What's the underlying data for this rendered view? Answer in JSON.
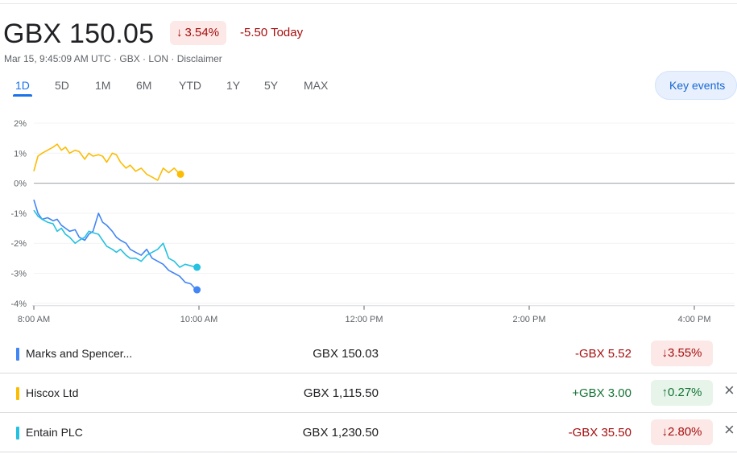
{
  "quote": {
    "price": "GBX 150.05",
    "change_pct": "3.54%",
    "change_today": "-5.50 Today",
    "meta": "Mar 15, 9:45:09 AM UTC · GBX · LON · Disclaimer"
  },
  "tabs": [
    {
      "label": "1D",
      "active": true
    },
    {
      "label": "5D"
    },
    {
      "label": "1M"
    },
    {
      "label": "6M"
    },
    {
      "label": "YTD"
    },
    {
      "label": "1Y"
    },
    {
      "label": "5Y"
    },
    {
      "label": "MAX"
    }
  ],
  "key_events_label": "Key events",
  "colors": {
    "blue": "#4285f4",
    "yellow": "#fbbc04",
    "teal": "#24c1e0",
    "red": "#a50e0e",
    "green": "#137333",
    "accent": "#1a73e8"
  },
  "chart_data": {
    "type": "line",
    "x_ticks": [
      "8:00 AM",
      "10:00 AM",
      "12:00 PM",
      "2:00 PM",
      "4:00 PM"
    ],
    "y_ticks": [
      "2%",
      "1%",
      "0%",
      "-1%",
      "-2%",
      "-3%",
      "-4%"
    ],
    "ylim": [
      -4,
      2
    ],
    "xlim_minutes_from_open": [
      0,
      510
    ],
    "grid": true,
    "baseline": 0,
    "series": [
      {
        "name": "Hiscox Ltd",
        "color": "#fbbc04",
        "x": [
          0,
          3,
          6,
          10,
          14,
          17,
          20,
          23,
          26,
          30,
          33,
          37,
          40,
          43,
          47,
          50,
          53,
          57,
          60,
          63,
          67,
          70,
          74,
          78,
          82,
          86,
          90,
          94,
          98,
          102,
          106
        ],
        "y": [
          0.4,
          0.9,
          1.0,
          1.1,
          1.2,
          1.3,
          1.1,
          1.2,
          1.0,
          1.1,
          1.05,
          0.8,
          1.0,
          0.9,
          0.95,
          0.9,
          0.7,
          1.0,
          0.95,
          0.7,
          0.5,
          0.6,
          0.4,
          0.5,
          0.3,
          0.2,
          0.1,
          0.5,
          0.35,
          0.5,
          0.3
        ]
      },
      {
        "name": "Marks and Spencer...",
        "color": "#4285f4",
        "x": [
          0,
          3,
          6,
          10,
          14,
          17,
          20,
          23,
          26,
          30,
          33,
          37,
          40,
          43,
          47,
          50,
          53,
          57,
          60,
          63,
          67,
          70,
          74,
          78,
          82,
          86,
          90,
          94,
          98,
          102,
          106,
          110,
          114,
          118
        ],
        "y": [
          -0.55,
          -1.0,
          -1.2,
          -1.15,
          -1.25,
          -1.2,
          -1.4,
          -1.5,
          -1.6,
          -1.55,
          -1.8,
          -1.9,
          -1.7,
          -1.6,
          -1.0,
          -1.3,
          -1.4,
          -1.6,
          -1.8,
          -1.9,
          -2.0,
          -2.2,
          -2.3,
          -2.4,
          -2.2,
          -2.5,
          -2.6,
          -2.7,
          -2.9,
          -3.0,
          -3.1,
          -3.3,
          -3.35,
          -3.55
        ]
      },
      {
        "name": "Entain PLC",
        "color": "#24c1e0",
        "x": [
          0,
          3,
          6,
          10,
          14,
          17,
          20,
          23,
          26,
          30,
          33,
          37,
          40,
          43,
          47,
          50,
          53,
          57,
          60,
          63,
          67,
          70,
          74,
          78,
          82,
          86,
          90,
          94,
          98,
          102,
          106,
          110,
          114,
          118
        ],
        "y": [
          -0.9,
          -1.1,
          -1.2,
          -1.3,
          -1.35,
          -1.6,
          -1.5,
          -1.7,
          -1.8,
          -2.0,
          -1.9,
          -1.8,
          -1.6,
          -1.65,
          -1.7,
          -1.9,
          -2.1,
          -2.2,
          -2.3,
          -2.2,
          -2.4,
          -2.5,
          -2.5,
          -2.6,
          -2.4,
          -2.3,
          -2.2,
          -2.0,
          -2.5,
          -2.6,
          -2.8,
          -2.7,
          -2.75,
          -2.8
        ]
      }
    ]
  },
  "comparisons": [
    {
      "name": "Marks and Spencer...",
      "color": "#4285f4",
      "price": "GBX 150.03",
      "change": "-GBX 5.52",
      "pct": "3.55%",
      "direction": "down",
      "removable": false
    },
    {
      "name": "Hiscox Ltd",
      "color": "#fbbc04",
      "price": "GBX 1,115.50",
      "change": "+GBX 3.00",
      "pct": "0.27%",
      "direction": "up",
      "removable": true
    },
    {
      "name": "Entain PLC",
      "color": "#24c1e0",
      "price": "GBX 1,230.50",
      "change": "-GBX 35.50",
      "pct": "2.80%",
      "direction": "down",
      "removable": true
    }
  ]
}
